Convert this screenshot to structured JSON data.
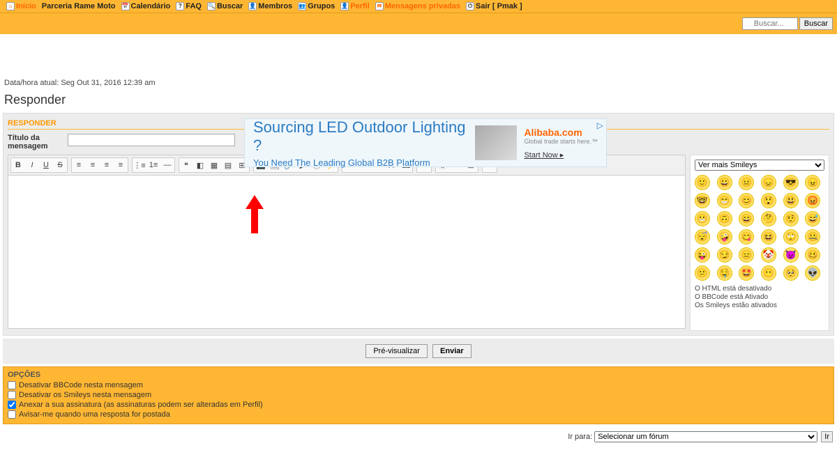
{
  "nav": {
    "inicio": "Início",
    "parceria": "Parceria Rame Moto",
    "calendario": "Calendário",
    "faq": "FAQ",
    "buscar": "Buscar",
    "membros": "Membros",
    "grupos": "Grupos",
    "perfil": "Perfil",
    "mensagens": "Mensagens privadas",
    "sair": "Sair [ Pmak ]"
  },
  "search": {
    "placeholder": "Buscar...",
    "button": "Buscar"
  },
  "datetime": "Data/hora atual: Seg Out 31, 2016 12:39 am",
  "page_title": "Responder",
  "section_header": "RESPONDER",
  "title_label": "Título da mensagem",
  "ad": {
    "line1": "Sourcing LED Outdoor Lighting ?",
    "line2": "You Need The Leading Global B2B Platform",
    "logo": "Alibaba.com",
    "sub": "Global trade starts here.™",
    "start": "Start Now ▸"
  },
  "toolbar": {
    "bold": "B",
    "italic": "I",
    "underline": "U",
    "strike": "S",
    "left": "≡",
    "center": "≡",
    "right": "≡",
    "justify": "≡",
    "ul": "⋮≡",
    "ol": "1≡",
    "hr": "—",
    "quote": "❝",
    "code": "◧",
    "spoiler": "▦",
    "hidden": "▤",
    "table": "⊞",
    "host": "📷",
    "img": "🖼",
    "link": "🔗",
    "yt": "▶",
    "dm": "ⓓ",
    "flash": "⚡",
    "h": "H",
    "fsize": "ᴬᴬ",
    "fcolor": "A",
    "font": "Ａ",
    "rmfmt": "⌫",
    "more": "⋯",
    "date": "📅",
    "emoji": "☺",
    "sw1": "⊡",
    "sw2": "≡"
  },
  "smileys": {
    "select": "Ver mais Smileys",
    "faces": [
      "🙂",
      "😀",
      "😐",
      "😞",
      "😎",
      "😠",
      "🤓",
      "😁",
      "😊",
      "😲",
      "😃",
      "😡",
      "😬",
      "🙃",
      "😄",
      "🤔",
      "🤨",
      "😅",
      "😴",
      "🤪",
      "😋",
      "😆",
      "🙄",
      "🤐",
      "😜",
      "😏",
      "😑",
      "🤡",
      "😈",
      "🥴",
      "😕",
      "🤤",
      "🤩",
      "😶",
      "🥺",
      "👽"
    ]
  },
  "status": {
    "html": "O HTML está desativado",
    "bbcode": "O BBCode está Ativado",
    "smileys": "Os Smileys estão ativados"
  },
  "buttons": {
    "preview": "Pré-visualizar",
    "send": "Enviar"
  },
  "options": {
    "header": "OPÇÕES",
    "opt1": "Desativar BBCode nesta mensagem",
    "opt2": "Desativar os Smileys nesta mensagem",
    "opt3": "Anexar a sua assinatura (as assinaturas podem ser alteradas em Perfil)",
    "opt4": "Avisar-me quando uma resposta for postada"
  },
  "jump": {
    "label": "Ir para:",
    "select": "Selecionar um fórum",
    "go": "Ir"
  }
}
